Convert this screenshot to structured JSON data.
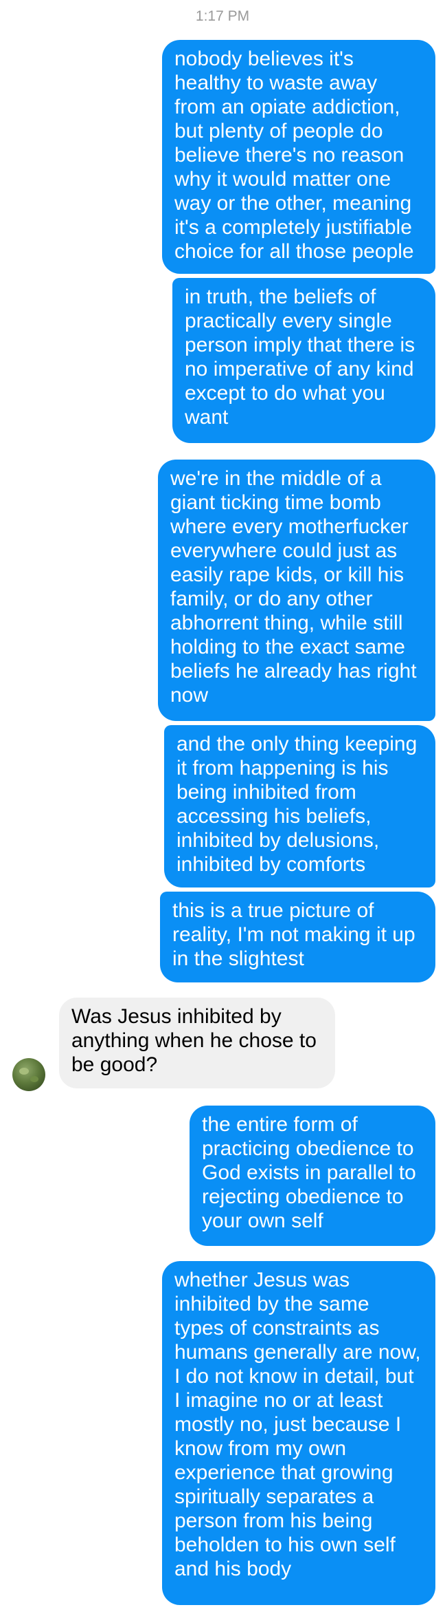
{
  "conversation": {
    "timestamp": "1:17 PM",
    "messages": [
      {
        "direction": "outgoing",
        "text": "nobody believes it's healthy to waste away from an opiate addiction, but plenty of people do believe there's no reason why it would matter one way or the other, meaning it's a completely justifiable choice for all those people"
      },
      {
        "direction": "outgoing",
        "text": "in truth, the beliefs of practically every single person imply that there is no imperative of any kind except to do what you want"
      },
      {
        "direction": "outgoing",
        "text": "we're in the middle of a giant ticking time bomb where every motherfucker everywhere could just as easily rape kids, or kill his family, or do any other abhorrent thing, while still holding to the exact same beliefs he already has right now"
      },
      {
        "direction": "outgoing",
        "text": "and the only thing keeping it from happening is his being inhibited from accessing his beliefs, inhibited by delusions, inhibited by comforts"
      },
      {
        "direction": "outgoing",
        "text": "this is a true picture of reality, I'm not making it up in the slightest"
      },
      {
        "direction": "incoming",
        "text": "Was Jesus inhibited by anything when he chose to be good?"
      },
      {
        "direction": "outgoing",
        "text": "the entire form of practicing obedience to God exists in parallel to rejecting obedience to your own self"
      },
      {
        "direction": "outgoing",
        "text": "whether Jesus was inhibited by the same types of constraints as humans generally are now, I do not know in detail, but I imagine no or at least mostly no, just because I know from my own experience that growing spiritually separates a person from his being beholden to his own self and his body"
      }
    ],
    "colors": {
      "outgoing_bubble": "#0a8ff5",
      "incoming_bubble": "#f0f0f0",
      "timestamp_text": "#9a9a9a"
    },
    "avatar_icon": "contact-avatar"
  }
}
